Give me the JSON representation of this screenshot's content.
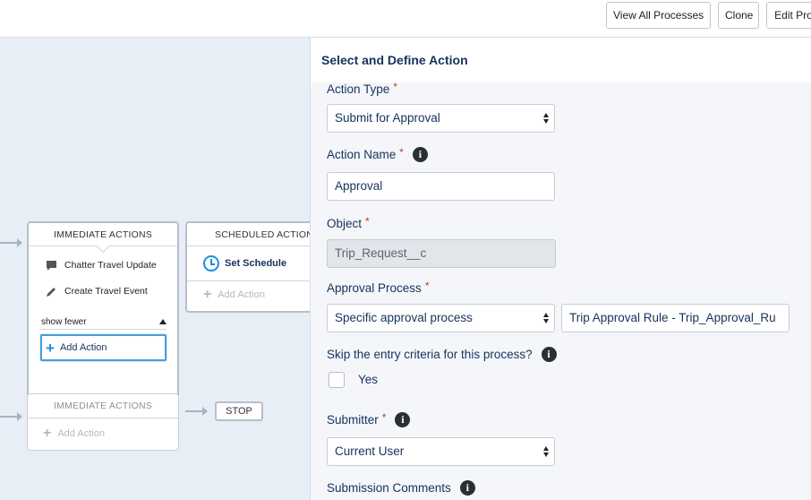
{
  "toolbar": {
    "view_all_label": "View All Processes",
    "clone_label": "Clone",
    "edit_label": "Edit Pro"
  },
  "canvas": {
    "immediate_actions_1": {
      "title": "IMMEDIATE ACTIONS",
      "actions": [
        {
          "label": "Chatter Travel Update",
          "icon": "chat-bubble-icon"
        },
        {
          "label": "Create Travel Event",
          "icon": "pencil-icon"
        }
      ],
      "show_fewer": "show fewer",
      "add_action": "Add Action"
    },
    "scheduled_actions": {
      "title": "SCHEDULED ACTIONS",
      "set_schedule": "Set Schedule",
      "add_action": "Add Action"
    },
    "immediate_actions_2": {
      "title": "IMMEDIATE ACTIONS",
      "add_action": "Add Action"
    },
    "stop": "STOP"
  },
  "panel": {
    "title": "Select and Define Action",
    "action_type": {
      "label": "Action Type",
      "value": "Submit for Approval"
    },
    "action_name": {
      "label": "Action Name",
      "value": "Approval"
    },
    "object": {
      "label": "Object",
      "value": "Trip_Request__c"
    },
    "approval_process": {
      "label": "Approval Process",
      "value": "Specific approval process",
      "process_value": "Trip Approval Rule - Trip_Approval_Ru"
    },
    "skip_entry": {
      "label": "Skip the entry criteria for this process?",
      "checkbox_label": "Yes",
      "checked": false
    },
    "submitter": {
      "label": "Submitter",
      "value": "Current User"
    },
    "submission_comments": {
      "label": "Submission Comments"
    },
    "required_marker": "*",
    "info_glyph": "i"
  },
  "colors": {
    "accent": "#1b8ce3",
    "required": "#c23934",
    "canvas_bg": "#e8eef6",
    "panel_bg": "#f4f6f9"
  }
}
